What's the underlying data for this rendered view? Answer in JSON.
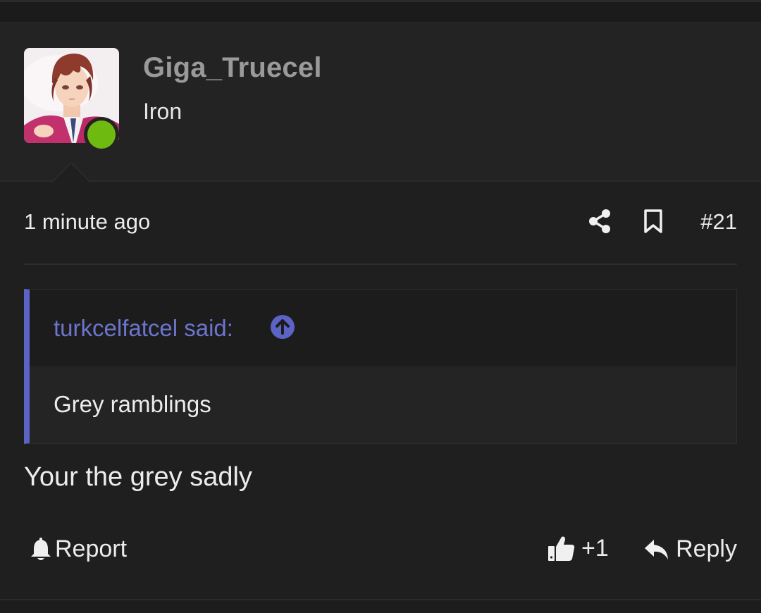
{
  "user": {
    "name": "Giga_Truecel",
    "title": "Iron",
    "avatar_icon": "anime-character-avatar",
    "online_status_color": "#6fba10"
  },
  "post": {
    "timestamp": "1 minute ago",
    "number": "#21",
    "body": "Your the grey sadly"
  },
  "quote": {
    "author": "turkcelfatcel said:",
    "text": "Grey ramblings",
    "accent_color": "#5b63c4"
  },
  "actions": {
    "report_label": "Report",
    "like_label": "+1",
    "reply_label": "Reply"
  }
}
